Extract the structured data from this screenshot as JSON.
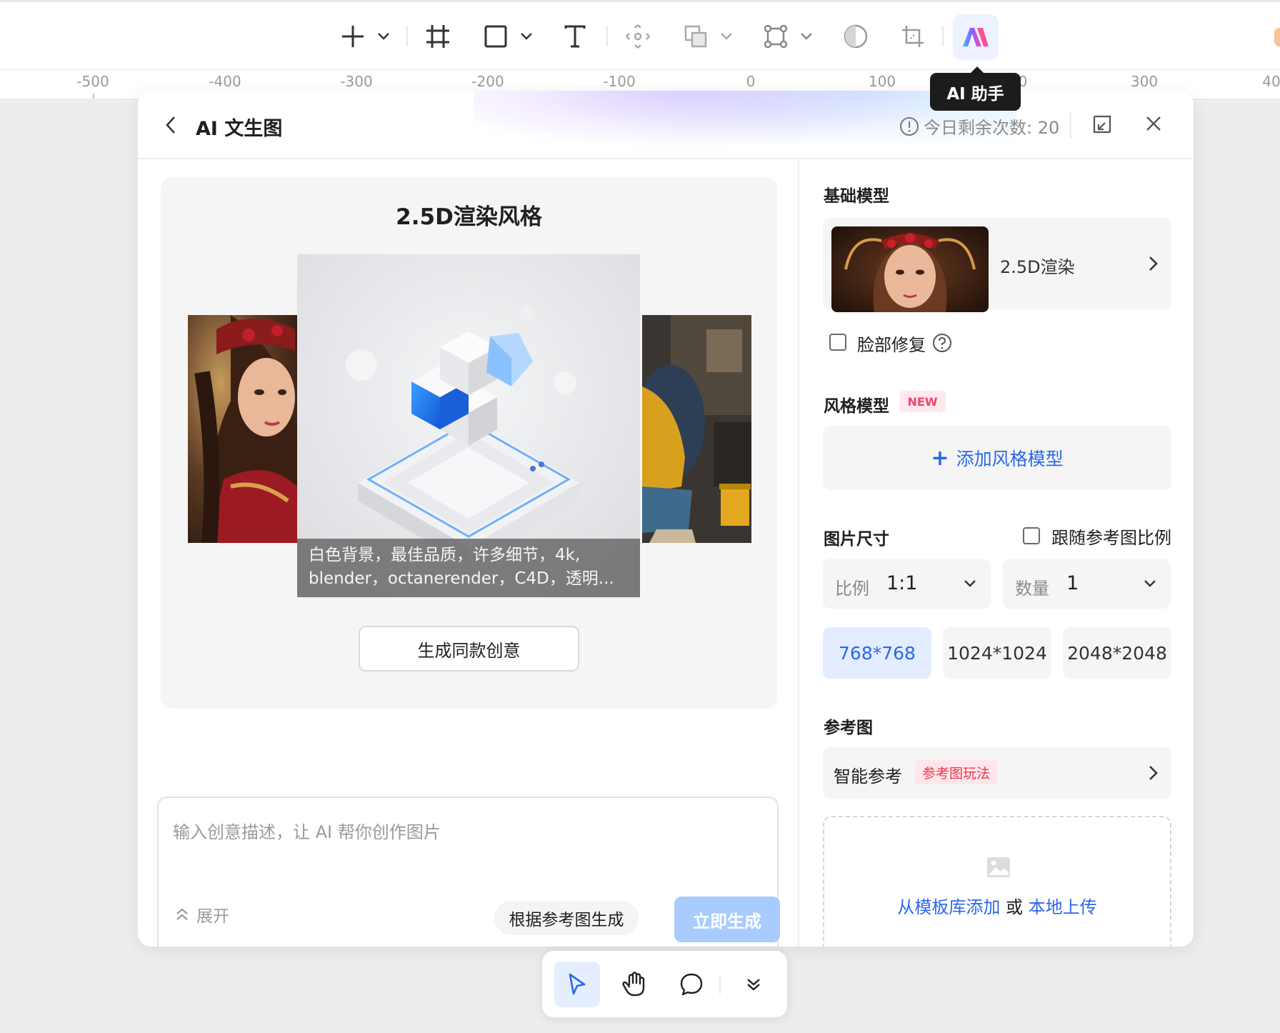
{
  "toolbar": {
    "tools": [
      {
        "name": "plus-icon"
      },
      {
        "name": "frame-icon"
      },
      {
        "name": "rectangle-icon"
      },
      {
        "name": "text-icon"
      },
      {
        "name": "move-icon"
      },
      {
        "name": "boolean-icon"
      },
      {
        "name": "component-icon"
      },
      {
        "name": "mask-icon"
      },
      {
        "name": "crop-icon"
      },
      {
        "name": "ai-assistant-icon"
      }
    ],
    "ai_tooltip": "AI 助手"
  },
  "ruler": {
    "ticks": [
      "-500",
      "-400",
      "-300",
      "-200",
      "-100",
      "0",
      "100",
      "0",
      "300",
      "40"
    ]
  },
  "panel": {
    "title": "AI 文生图",
    "quota_label": "今日剩余次数: 20"
  },
  "showcase": {
    "title": "2.5D渲染风格",
    "caption_line1": "白色背景，最佳品质，许多细节，4k,",
    "caption_line2": "blender，octanerender，C4D，透明...",
    "generate_same_label": "生成同款创意"
  },
  "prompt": {
    "placeholder": "输入创意描述，让 AI 帮你创作图片",
    "expand_label": "展开",
    "ref_generate_label": "根据参考图生成",
    "generate_now_label": "立即生成"
  },
  "config": {
    "base_model_label": "基础模型",
    "base_model_name": "2.5D渲染",
    "face_fix_label": "脸部修复",
    "style_model_label": "风格模型",
    "new_badge": "NEW",
    "add_style_label": "添加风格模型",
    "image_size_label": "图片尺寸",
    "follow_ratio_label": "跟随参考图比例",
    "ratio_label": "比例",
    "ratio_value": "1:1",
    "count_label": "数量",
    "count_value": "1",
    "sizes": [
      "768*768",
      "1024*1024",
      "2048*2048"
    ],
    "selected_size": "768*768",
    "reference_label": "参考图",
    "smart_ref_label": "智能参考",
    "smart_ref_badge": "参考图玩法",
    "upload_template_link": "从模板库添加",
    "upload_or": " 或 ",
    "upload_local_link": "本地上传"
  },
  "colors": {
    "accent": "#2a68e8",
    "primary_disabled": "#a8ccff",
    "new_badge": "#f0436d"
  },
  "bottom_toolbar": {
    "tools": [
      "pointer-icon",
      "hand-icon",
      "comment-icon",
      "chevron-double-down-icon"
    ],
    "active": "pointer-icon"
  }
}
